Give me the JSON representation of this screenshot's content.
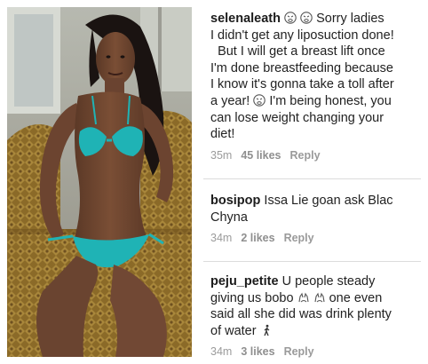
{
  "comments": [
    {
      "username": "selenaleath",
      "lines": [
        "Sorry ladies",
        "I didn't get any liposuction done!",
        "But I will get a breast lift once",
        "I'm done breastfeeding because",
        "I know it's gonna take a toll after",
        "a year!",
        "I'm being honest, you",
        "can lose weight changing your",
        "diet!"
      ],
      "time": "35m",
      "likes": "45 likes",
      "reply": "Reply",
      "emoji_icons": [
        "weary-face-icon",
        "weary-face-icon",
        "weary-face-icon"
      ]
    },
    {
      "username": "bosipop",
      "lines": [
        "Issa Lie goan ask Blac",
        "Chyna"
      ],
      "time": "34m",
      "likes": "2 likes",
      "reply": "Reply"
    },
    {
      "username": "peju_petite",
      "lines": [
        "U people steady",
        "giving us bobo",
        "one even",
        "said all she did was drink plenty",
        "of water"
      ],
      "time": "34m",
      "likes": "3 likes",
      "reply": "Reply",
      "emoji_icons": [
        "raised-hands-icon",
        "raised-hands-icon",
        "walking-person-icon"
      ]
    }
  ],
  "colors": {
    "text": "#222222",
    "meta": "#9b9b9b",
    "divider": "#dcdcdc",
    "swimsuit": "#1fb3b5",
    "couch": "#8a6a2a"
  }
}
